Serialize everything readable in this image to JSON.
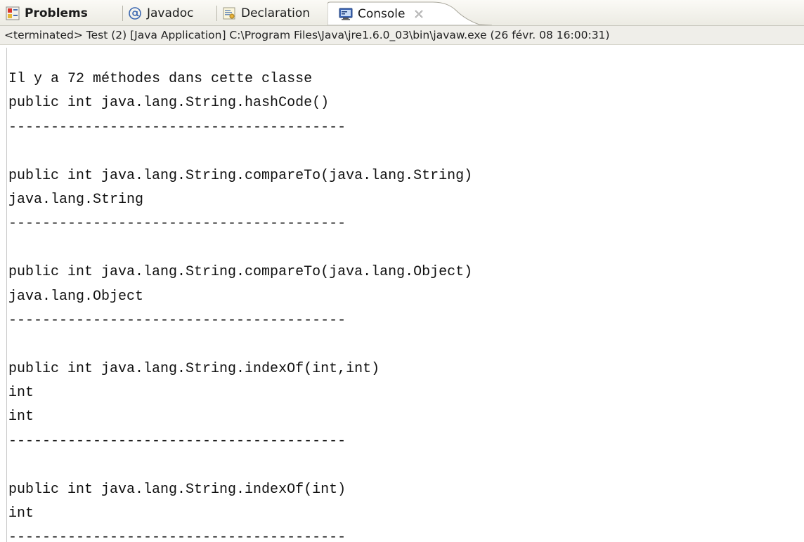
{
  "tabs": [
    {
      "label": "Problems",
      "icon": "problems-icon",
      "active": false
    },
    {
      "label": "Javadoc",
      "icon": "at-sign-icon",
      "active": false
    },
    {
      "label": "Declaration",
      "icon": "declaration-icon",
      "active": false
    },
    {
      "label": "Console",
      "icon": "console-icon",
      "active": true,
      "closable": true
    }
  ],
  "status": {
    "text": "<terminated> Test (2) [Java Application] C:\\Program Files\\Java\\jre1.6.0_03\\bin\\javaw.exe (26 févr. 08 16:00:31)"
  },
  "console": {
    "lines": [
      "Il y a 72 méthodes dans cette classe",
      "public int java.lang.String.hashCode()",
      "----------------------------------------",
      "",
      "public int java.lang.String.compareTo(java.lang.String)",
      "java.lang.String",
      "----------------------------------------",
      "",
      "public int java.lang.String.compareTo(java.lang.Object)",
      "java.lang.Object",
      "----------------------------------------",
      "",
      "public int java.lang.String.indexOf(int,int)",
      "int",
      "int",
      "----------------------------------------",
      "",
      "public int java.lang.String.indexOf(int)",
      "int",
      "----------------------------------------"
    ]
  },
  "colors": {
    "tab_bar": "#ecebe3",
    "active_tab": "#ffffff",
    "status_bg": "#efeee9",
    "text": "#111111"
  }
}
